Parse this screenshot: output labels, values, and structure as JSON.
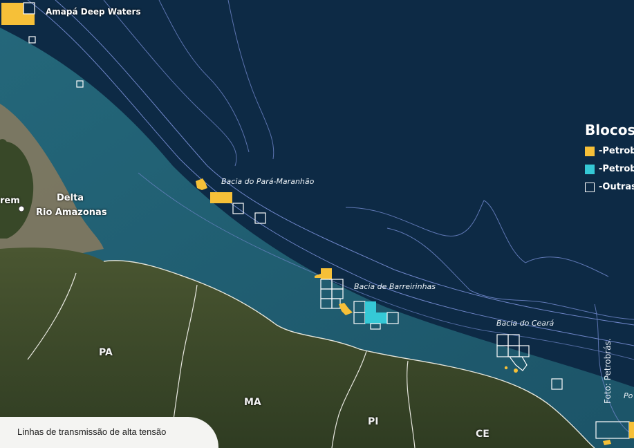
{
  "map": {
    "colors": {
      "deep_ocean": "#0d2a45",
      "shelf_water": "#1f5e73",
      "land": "#3c4a2a",
      "contour": "#6f86c9",
      "petrobras_operated": "#f6c038",
      "petrobras_partner": "#35c9d6",
      "other_companies": "#ffffff"
    },
    "place_labels": {
      "amapa_deep_waters": "Amapá Deep Waters",
      "belem_fragment": "rem",
      "delta_line1": "Delta",
      "delta_line2": "Rio Amazonas"
    },
    "basin_labels": {
      "para_maranhao": "Bacia do Pará-Maranhão",
      "barreirinhas": "Bacia de Barreirinhas",
      "ceara": "Bacia do Ceará",
      "potiguar_fragment": "Po"
    },
    "state_labels": {
      "pa": "PA",
      "ma": "MA",
      "pi": "PI",
      "ce": "CE"
    },
    "legend": {
      "title": "Blocos",
      "items": [
        {
          "label": "-Petrob",
          "color": "#f6c038",
          "icon": "filled-square-icon"
        },
        {
          "label": "-Petrob",
          "color": "#35c9d6",
          "icon": "filled-square-icon"
        },
        {
          "label": "-Outras",
          "color": "#ffffff",
          "icon": "outline-square-icon"
        }
      ]
    },
    "credit": "Foto: Petrobrás.",
    "bottom_panel_label": "Linhas de transmissão de alta tensão"
  }
}
